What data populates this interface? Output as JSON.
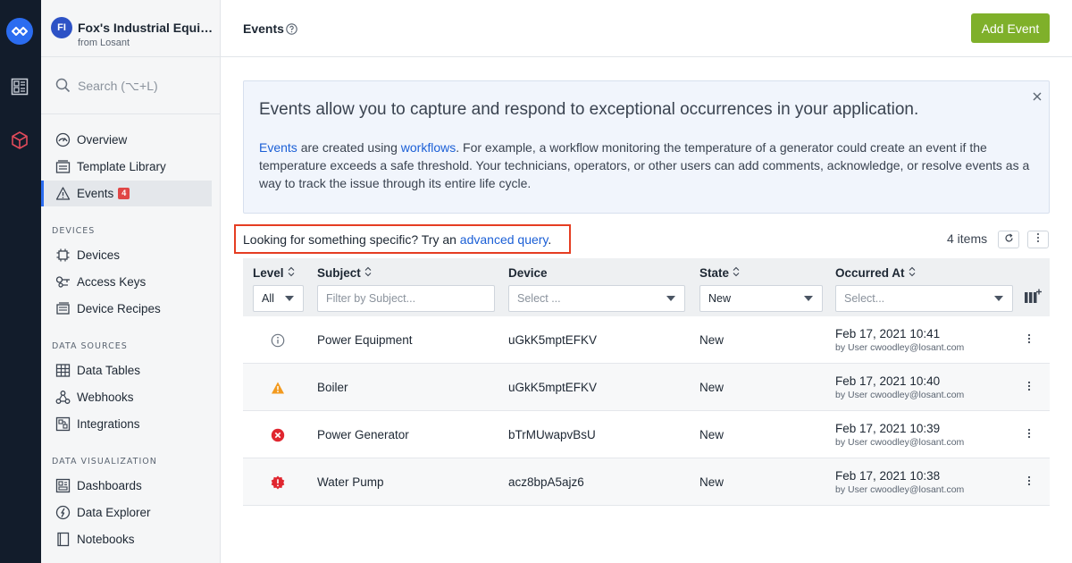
{
  "app": {
    "initials": "FI",
    "name": "Fox's Industrial Equipment",
    "org": "from Losant"
  },
  "search": {
    "placeholder": "Search (⌥+L)"
  },
  "sidebar": {
    "top_items": [
      {
        "label": "Overview",
        "icon": "overview-icon"
      },
      {
        "label": "Template Library",
        "icon": "template-library-icon"
      },
      {
        "label": "Events",
        "icon": "warning-icon",
        "badge": "4",
        "active": true
      }
    ],
    "sections": [
      {
        "label": "DEVICES",
        "items": [
          {
            "label": "Devices",
            "icon": "chip-icon"
          },
          {
            "label": "Access Keys",
            "icon": "key-icon"
          },
          {
            "label": "Device Recipes",
            "icon": "recipe-icon"
          }
        ]
      },
      {
        "label": "DATA SOURCES",
        "items": [
          {
            "label": "Data Tables",
            "icon": "table-icon"
          },
          {
            "label": "Webhooks",
            "icon": "webhook-icon"
          },
          {
            "label": "Integrations",
            "icon": "integrations-icon"
          }
        ]
      },
      {
        "label": "DATA VISUALIZATION",
        "items": [
          {
            "label": "Dashboards",
            "icon": "dashboard-icon"
          },
          {
            "label": "Data Explorer",
            "icon": "data-explorer-icon"
          },
          {
            "label": "Notebooks",
            "icon": "notebook-icon"
          }
        ]
      }
    ]
  },
  "header": {
    "title": "Events",
    "add_label": "Add Event"
  },
  "info": {
    "title": "Events allow you to capture and respond to exceptional occurrences in your application.",
    "link1": "Events",
    "text1": " are created using ",
    "link2": "workflows",
    "text2": ". For example, a workflow monitoring the temperature of a generator could create an event if the temperature exceeds a safe threshold. Your technicians, operators, or other users can add comments, acknowledge, or resolve events as a way to track the issue through its entire life cycle."
  },
  "query": {
    "prefix": "Looking for something specific? Try an ",
    "link": "advanced query",
    "suffix": "."
  },
  "count": "4 items",
  "table": {
    "columns": [
      "Level",
      "Subject",
      "Device",
      "State",
      "Occurred At"
    ],
    "filters": {
      "level": "All",
      "subject_placeholder": "Filter by Subject...",
      "device_placeholder": "Select ...",
      "state": "New",
      "occurred_placeholder": "Select..."
    },
    "rows": [
      {
        "level": "info",
        "subject": "Power Equipment",
        "device": "uGkK5mptEFKV",
        "state": "New",
        "time": "Feb 17, 2021 10:41",
        "by": "by User cwoodley@losant.com"
      },
      {
        "level": "warning",
        "subject": "Boiler",
        "device": "uGkK5mptEFKV",
        "state": "New",
        "time": "Feb 17, 2021 10:40",
        "by": "by User cwoodley@losant.com"
      },
      {
        "level": "error",
        "subject": "Power Generator",
        "device": "bTrMUwapvBsU",
        "state": "New",
        "time": "Feb 17, 2021 10:39",
        "by": "by User cwoodley@losant.com"
      },
      {
        "level": "critical",
        "subject": "Water Pump",
        "device": "acz8bpA5ajz6",
        "state": "New",
        "time": "Feb 17, 2021 10:38",
        "by": "by User cwoodley@losant.com"
      }
    ]
  },
  "colors": {
    "accent": "#2b6cf0",
    "add_button": "#7fb02a",
    "highlight": "#e53d22",
    "link": "#1b5fd6"
  }
}
